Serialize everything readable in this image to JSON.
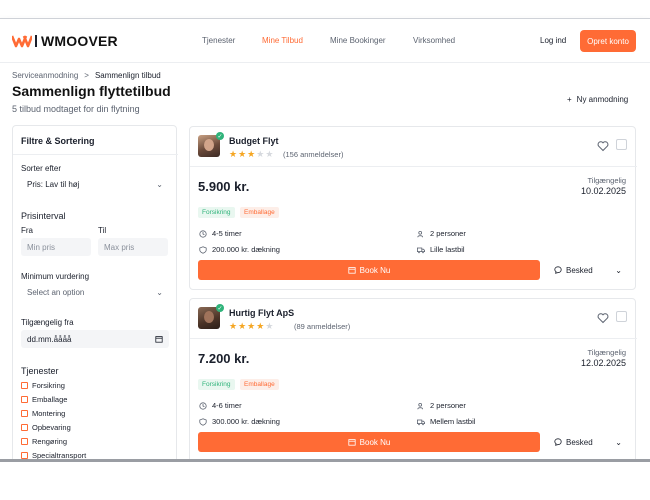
{
  "header": {
    "brand": "WMOOVER",
    "nav": [
      {
        "label": "Tjenester",
        "active": false
      },
      {
        "label": "Mine Tilbud",
        "active": true
      },
      {
        "label": "Mine Bookinger",
        "active": false
      },
      {
        "label": "Virksomhed",
        "active": false
      }
    ],
    "login": "Log ind",
    "cta": "Opret konto"
  },
  "breadcrumb": {
    "parent": "Serviceanmodning",
    "separator": ">",
    "current": "Sammenlign tilbud"
  },
  "page": {
    "title": "Sammenlign flyttetilbud",
    "subtitle": "5 tilbud modtaget for din flytning",
    "new_request": "Ny anmodning"
  },
  "filters": {
    "title": "Filtre & Sortering",
    "sort_label": "Sorter efter",
    "sort_value": "Pris: Lav til høj",
    "price_section": "Prisinterval",
    "from_label": "Fra",
    "to_label": "Til",
    "min_placeholder": "Min pris",
    "max_placeholder": "Max pris",
    "rating_label": "Minimum vurdering",
    "rating_value": "Select an option",
    "date_label": "Tilgængelig fra",
    "date_value": "dd.mm.åååå",
    "services_section": "Tjenester",
    "services": [
      "Forsikring",
      "Emballage",
      "Montering",
      "Opbevaring",
      "Rengøring",
      "Specialtransport"
    ]
  },
  "offers": [
    {
      "company": "Budget Flyt",
      "rating": 3,
      "reviews": "(156 anmeldelser)",
      "price": "5.900 kr.",
      "available_label": "Tilgængelig",
      "available_date": "10.02.2025",
      "tags": [
        "Forsikring",
        "Emballage"
      ],
      "duration": "4-5 timer",
      "coverage": "200.000 kr. dækning",
      "people": "2 personer",
      "vehicle": "Lille lastbil",
      "book_label": "Book Nu",
      "message_label": "Besked"
    },
    {
      "company": "Hurtig Flyt ApS",
      "rating": 4,
      "reviews": "(89 anmeldelser)",
      "price": "7.200 kr.",
      "available_label": "Tilgængelig",
      "available_date": "12.02.2025",
      "tags": [
        "Forsikring",
        "Emballage"
      ],
      "duration": "4-6 timer",
      "coverage": "300.000 kr. dækning",
      "people": "2 personer",
      "vehicle": "Mellem lastbil",
      "book_label": "Book Nu",
      "message_label": "Besked"
    }
  ],
  "colors": {
    "accent": "#ff6b35",
    "success": "#2fb37a",
    "star": "#f5a623"
  }
}
